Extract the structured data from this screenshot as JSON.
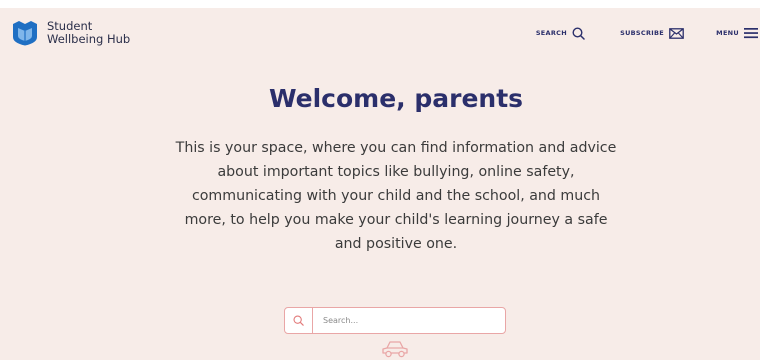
{
  "brand": {
    "name_line1": "Student",
    "name_line2": "Wellbeing Hub",
    "logo_icon": "shield-book-logo",
    "colors": {
      "navy": "#2b2f6b",
      "blue": "#1f6fc3",
      "pink": "#e9a6a6",
      "background": "#f7ece8"
    }
  },
  "nav": {
    "search_label": "SEARCH",
    "search_icon": "search-icon",
    "subscribe_label": "SUBSCRIBE",
    "subscribe_icon": "envelope-icon",
    "menu_label": "MENU",
    "menu_icon": "hamburger-icon"
  },
  "hero": {
    "title": "Welcome, parents",
    "intro": "This is your space, where you can find information and advice about important topics like bullying, online safety, communicating with your child and the school, and much more, to help you make your child's learning journey a safe and positive one."
  },
  "search": {
    "placeholder": "Search...",
    "value": "",
    "icon": "search-icon"
  },
  "decorations": {
    "car_icon": "car-icon"
  }
}
